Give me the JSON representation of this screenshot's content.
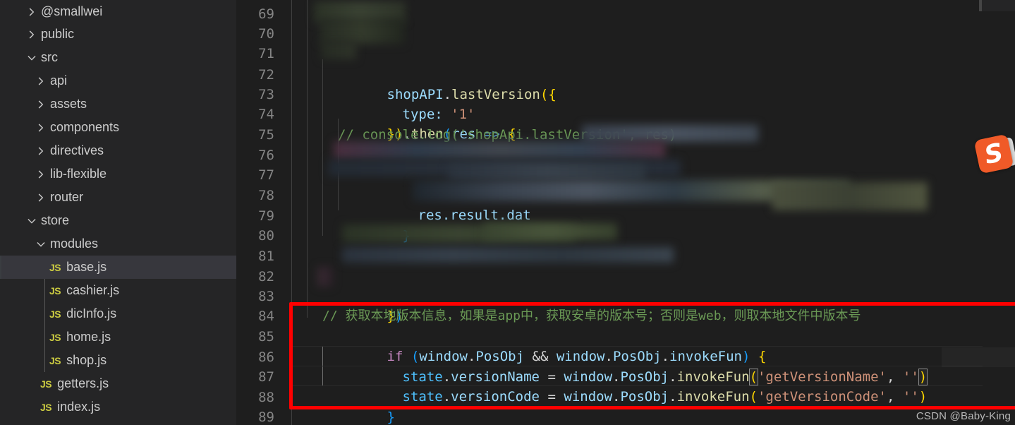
{
  "app": {
    "theme_bg": "#1e1e1e",
    "sidebar_bg": "#252526",
    "accent_red": "#ff0000",
    "comment_green": "#6a9955",
    "string_orange": "#ce9178"
  },
  "sidebar": {
    "name": "explorer-file-tree",
    "items": [
      {
        "label": "@smallwei",
        "type": "folder",
        "expanded": false,
        "depth": 1,
        "icon": "chevron-right-icon"
      },
      {
        "label": "public",
        "type": "folder",
        "expanded": false,
        "depth": 0,
        "icon": "chevron-right-icon"
      },
      {
        "label": "src",
        "type": "folder",
        "expanded": true,
        "depth": 0,
        "icon": "chevron-down-icon"
      },
      {
        "label": "api",
        "type": "folder",
        "expanded": false,
        "depth": 1,
        "icon": "chevron-right-icon"
      },
      {
        "label": "assets",
        "type": "folder",
        "expanded": false,
        "depth": 1,
        "icon": "chevron-right-icon"
      },
      {
        "label": "components",
        "type": "folder",
        "expanded": false,
        "depth": 1,
        "icon": "chevron-right-icon"
      },
      {
        "label": "directives",
        "type": "folder",
        "expanded": false,
        "depth": 1,
        "icon": "chevron-right-icon"
      },
      {
        "label": "lib-flexible",
        "type": "folder",
        "expanded": false,
        "depth": 1,
        "icon": "chevron-right-icon"
      },
      {
        "label": "router",
        "type": "folder",
        "expanded": false,
        "depth": 1,
        "icon": "chevron-right-icon"
      },
      {
        "label": "store",
        "type": "folder",
        "expanded": true,
        "depth": 1,
        "icon": "chevron-down-icon"
      },
      {
        "label": "modules",
        "type": "folder",
        "expanded": true,
        "depth": 2,
        "icon": "chevron-down-icon"
      },
      {
        "label": "base.js",
        "type": "file",
        "badge": "JS",
        "depth": 3,
        "selected": true
      },
      {
        "label": "cashier.js",
        "type": "file",
        "badge": "JS",
        "depth": 3,
        "selected": false
      },
      {
        "label": "dicInfo.js",
        "type": "file",
        "badge": "JS",
        "depth": 3,
        "selected": false
      },
      {
        "label": "home.js",
        "type": "file",
        "badge": "JS",
        "depth": 3,
        "selected": false
      },
      {
        "label": "shop.js",
        "type": "file",
        "badge": "JS",
        "depth": 3,
        "selected": false
      },
      {
        "label": "getters.js",
        "type": "file",
        "badge": "JS",
        "depth": 2,
        "selected": false
      },
      {
        "label": "index.js",
        "type": "file",
        "badge": "JS",
        "depth": 2,
        "selected": false
      }
    ]
  },
  "editor": {
    "name": "code-editor",
    "language": "javascript",
    "line_numbers": [
      "69",
      "70",
      "71",
      "72",
      "73",
      "74",
      "75",
      "76",
      "77",
      "78",
      "79",
      "80",
      "81",
      "82",
      "83",
      "84",
      "85",
      "86",
      "87",
      "88",
      "89"
    ],
    "lines": {
      "72": "shopAPI.lastVersion({",
      "73": "  type: '1'",
      "74": "}).then(res => {",
      "75": "  // console.log('shopApi.lastVersion', res)",
      "78": "    res.result.dat",
      "79": "  }",
      "83": "})",
      "84": "  // 获取本地版本信息，如果是app中，获取安卓的版本号；否则是web，则取本地文件中版本号",
      "85": "  if (window.PosObj && window.PosObj.invokeFun) {",
      "86": "    state.versionName = window.PosObj.invokeFun('getVersionName', '')",
      "87": "    state.versionCode = window.PosObj.invokeFun('getVersionCode', '')",
      "88": "  }"
    },
    "tokens": {
      "shopAPI": "shopAPI",
      "dot": ".",
      "lastVersion": "lastVersion",
      "type_key": "type:",
      "type_val": "'1'",
      "then": "then",
      "res": "res",
      "arrow": "=>",
      "comment_75": "// console.log('shopApi.lastVersion', res)",
      "res_result_dat": "res.result.dat",
      "comment_84": "// 获取本地版本信息，如果是app中，获取安卓的版本号；否则是web，则取本地文件中版本号",
      "if": "if",
      "window": "window",
      "PosObj": "PosObj",
      "and": "&&",
      "invokeFun": "invokeFun",
      "state": "state",
      "versionName": "versionName",
      "versionCode": "versionCode",
      "eq": "=",
      "str_getVersionName": "'getVersionName'",
      "str_getVersionCode": "'getVersionCode'",
      "str_empty": "''",
      "comma": ",",
      "lbrace": "{",
      "rbrace": "}",
      "lparen": "(",
      "rparen": ")"
    }
  },
  "annotation": {
    "name": "red-highlight-box",
    "color": "#ff0000",
    "covers_lines": "84-88"
  },
  "watermark": {
    "text": "CSDN @Baby-King"
  },
  "tray": {
    "sogou_logo_label": "S"
  }
}
